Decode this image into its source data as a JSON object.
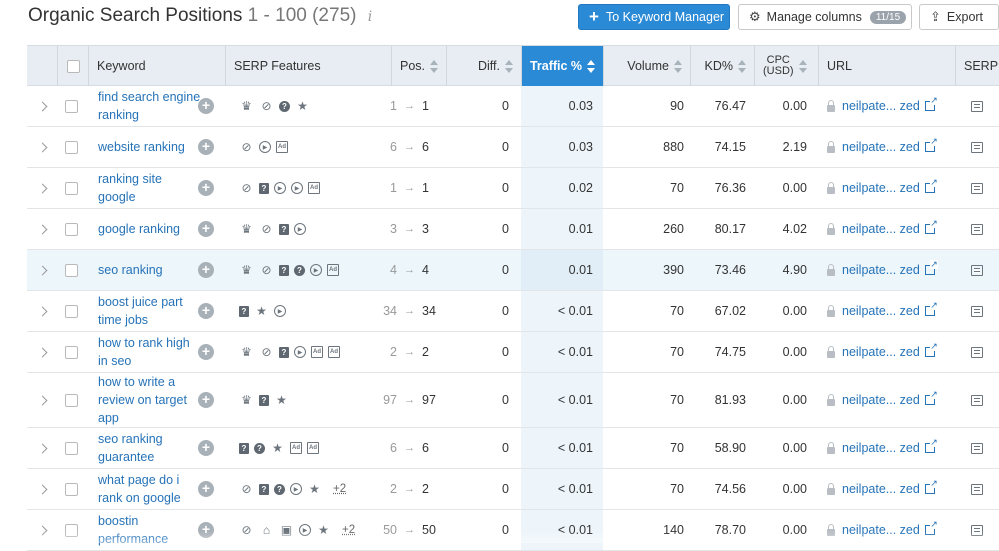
{
  "header": {
    "title": "Organic Search Positions",
    "range": "1 - 100 (275)",
    "info": "i",
    "keyword_manager_label": "To Keyword Manager",
    "manage_columns_label": "Manage columns",
    "columns_badge": "11/15",
    "export_label": "Export"
  },
  "columns": {
    "keyword": "Keyword",
    "serp_features": "SERP Features",
    "pos": "Pos.",
    "diff": "Diff.",
    "traffic": "Traffic %",
    "volume": "Volume",
    "kd": "KD%",
    "cpc_line1": "CPC",
    "cpc_line2": "(USD)",
    "url": "URL",
    "serp": "SERP"
  },
  "sorted_column": "traffic",
  "rows": [
    {
      "keyword": "find search engine ranking",
      "features": [
        "crown-icon",
        "link-icon",
        "question-icon",
        "star-icon"
      ],
      "more": "",
      "prev_pos": "1",
      "pos": "1",
      "diff": "0",
      "traffic": "0.03",
      "volume": "90",
      "kd": "76.47",
      "cpc": "0.00",
      "url": "neilpate... zed",
      "h": 41
    },
    {
      "keyword": "website ranking",
      "features": [
        "link-icon",
        "video-icon",
        "ad-icon"
      ],
      "more": "",
      "prev_pos": "6",
      "pos": "6",
      "diff": "0",
      "traffic": "0.03",
      "volume": "880",
      "kd": "74.15",
      "cpc": "2.19",
      "url": "neilpate... zed",
      "h": 41
    },
    {
      "keyword": "ranking site google",
      "features": [
        "link-icon",
        "faq-icon",
        "video-icon",
        "video-icon",
        "ad-icon"
      ],
      "more": "",
      "prev_pos": "1",
      "pos": "1",
      "diff": "0",
      "traffic": "0.02",
      "volume": "70",
      "kd": "76.36",
      "cpc": "0.00",
      "url": "neilpate... zed",
      "h": 41
    },
    {
      "keyword": "google ranking",
      "features": [
        "crown-icon",
        "link-icon",
        "faq-icon",
        "video-icon"
      ],
      "more": "",
      "prev_pos": "3",
      "pos": "3",
      "diff": "0",
      "traffic": "0.01",
      "volume": "260",
      "kd": "80.17",
      "cpc": "4.02",
      "url": "neilpate... zed",
      "h": 41
    },
    {
      "keyword": "seo ranking",
      "features": [
        "crown-icon",
        "link-icon",
        "faq-icon",
        "question-icon",
        "video-icon",
        "ad-icon"
      ],
      "more": "",
      "prev_pos": "4",
      "pos": "4",
      "diff": "0",
      "traffic": "0.01",
      "volume": "390",
      "kd": "73.46",
      "cpc": "4.90",
      "url": "neilpate... zed",
      "h": 41,
      "highlight": true
    },
    {
      "keyword": "boost juice part time jobs",
      "features": [
        "faq-icon",
        "star-icon",
        "video-icon"
      ],
      "more": "",
      "prev_pos": "34",
      "pos": "34",
      "diff": "0",
      "traffic": "< 0.01",
      "volume": "70",
      "kd": "67.02",
      "cpc": "0.00",
      "url": "neilpate... zed",
      "h": 41
    },
    {
      "keyword": "how to rank high in seo",
      "features": [
        "crown-icon",
        "link-icon",
        "faq-icon",
        "video-icon",
        "ad-icon",
        "ad-bottom-icon"
      ],
      "more": "",
      "prev_pos": "2",
      "pos": "2",
      "diff": "0",
      "traffic": "< 0.01",
      "volume": "70",
      "kd": "74.75",
      "cpc": "0.00",
      "url": "neilpate... zed",
      "h": 41
    },
    {
      "keyword": "how to write a review on target app",
      "features": [
        "crown-icon",
        "faq-icon",
        "star-icon"
      ],
      "more": "",
      "prev_pos": "97",
      "pos": "97",
      "diff": "0",
      "traffic": "< 0.01",
      "volume": "70",
      "kd": "81.93",
      "cpc": "0.00",
      "url": "neilpate... zed",
      "h": 55
    },
    {
      "keyword": "seo ranking guarantee",
      "features": [
        "faq-icon",
        "question-icon",
        "star-icon",
        "ad-icon",
        "ad-bottom-icon"
      ],
      "more": "",
      "prev_pos": "6",
      "pos": "6",
      "diff": "0",
      "traffic": "< 0.01",
      "volume": "70",
      "kd": "58.90",
      "cpc": "0.00",
      "url": "neilpate... zed",
      "h": 41
    },
    {
      "keyword": "what page do i rank on google",
      "features": [
        "link-icon",
        "faq-icon",
        "question-icon",
        "video-icon",
        "star-icon"
      ],
      "more": "+2",
      "prev_pos": "2",
      "pos": "2",
      "diff": "0",
      "traffic": "< 0.01",
      "volume": "70",
      "kd": "74.56",
      "cpc": "0.00",
      "url": "neilpate... zed",
      "h": 41
    },
    {
      "keyword": "boostin performance",
      "features": [
        "link-icon",
        "graduation-icon",
        "image-icon",
        "video-icon",
        "star-icon"
      ],
      "more": "+2",
      "prev_pos": "50",
      "pos": "50",
      "diff": "0",
      "traffic": "< 0.01",
      "volume": "140",
      "kd": "78.70",
      "cpc": "0.00",
      "url": "neilpate... zed",
      "h": 41
    }
  ],
  "icon_glyphs": {
    "crown-icon": "♛",
    "link-icon": "🔗",
    "question-icon": "?",
    "star-icon": "★",
    "video-icon": "▸",
    "ad-icon": "Ad",
    "ad-bottom-icon": "Ad",
    "faq-icon": "?",
    "graduation-icon": "🎓",
    "image-icon": "▣"
  },
  "colors": {
    "accent": "#2b8ad6",
    "link": "#2673b8",
    "header_bg": "#e7edf2",
    "row_highlight": "#edf6fb"
  }
}
